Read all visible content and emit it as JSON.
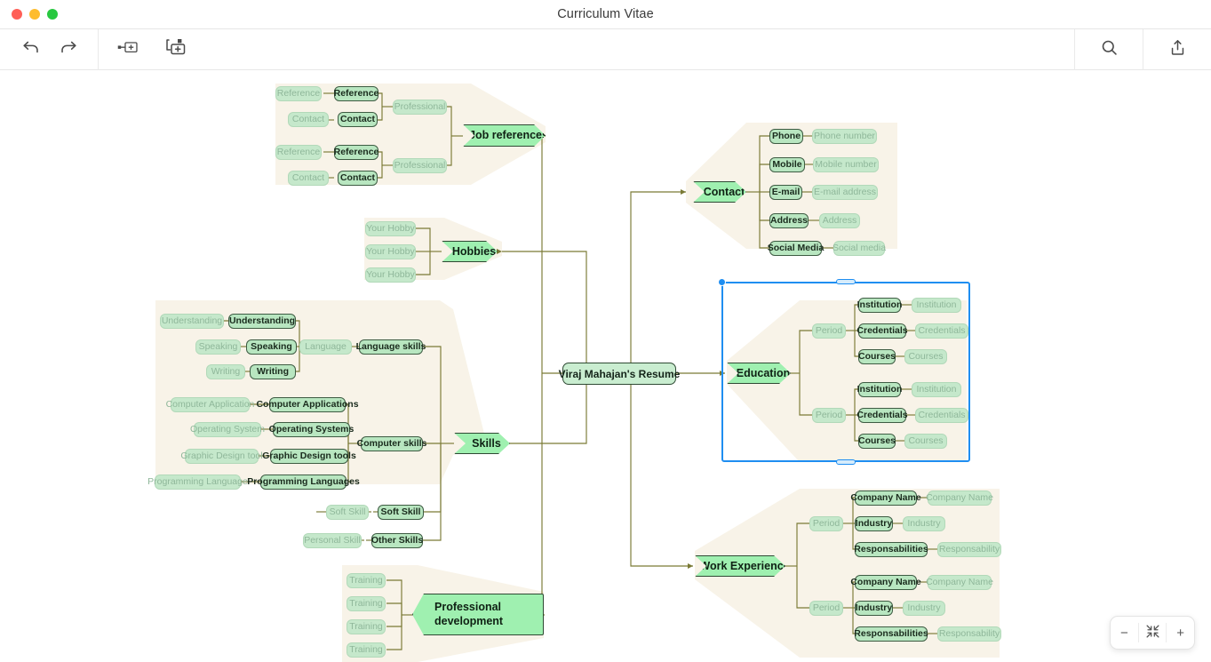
{
  "window": {
    "title": "Curriculum Vitae",
    "traffic_lights": [
      "close",
      "minimize",
      "maximize"
    ]
  },
  "toolbar": {
    "undo_icon": "undo-arrow-icon",
    "redo_icon": "redo-arrow-icon",
    "add_sibling_icon": "add-sibling-node-icon",
    "add_child_icon": "add-child-node-icon",
    "search_icon": "search-icon",
    "share_icon": "share-export-icon"
  },
  "zoom_controls": {
    "zoom_out": "−",
    "fit_screen": "fit-to-screen-icon",
    "zoom_in": "+"
  },
  "mindmap": {
    "root": "Viraj Mahajan's Resume",
    "selected_branch": "Education",
    "branches": [
      {
        "label": "Job references",
        "side": "left",
        "groups": [
          {
            "label": "Professional",
            "items": [
              {
                "label": "Reference",
                "placeholder": "Reference"
              },
              {
                "label": "Contact",
                "placeholder": "Contact"
              }
            ]
          },
          {
            "label": "Professional",
            "items": [
              {
                "label": "Reference",
                "placeholder": "Reference"
              },
              {
                "label": "Contact",
                "placeholder": "Contact"
              }
            ]
          }
        ]
      },
      {
        "label": "Hobbies",
        "side": "left",
        "leaves": [
          "Your Hobby",
          "Your Hobby",
          "Your Hobby"
        ]
      },
      {
        "label": "Skills",
        "side": "left",
        "groups": [
          {
            "label": "Language skills",
            "sub": "Language",
            "items": [
              {
                "label": "Understanding",
                "placeholder": "Understanding"
              },
              {
                "label": "Speaking",
                "placeholder": "Speaking"
              },
              {
                "label": "Writing",
                "placeholder": "Writing"
              }
            ]
          },
          {
            "label": "Computer skills",
            "items": [
              {
                "label": "Computer Applications",
                "placeholder": "Computer Application"
              },
              {
                "label": "Operating Systems",
                "placeholder": "Operating System"
              },
              {
                "label": "Graphic Design tools",
                "placeholder": "Graphic Design tool"
              },
              {
                "label": "Programming Languages",
                "placeholder": "Programming Language"
              }
            ]
          },
          {
            "label": "Soft Skill",
            "placeholder": "Soft Skill"
          },
          {
            "label": "Other Skills",
            "placeholder": "Personal Skill"
          }
        ]
      },
      {
        "label": "Professional development",
        "side": "left",
        "leaves": [
          "Training",
          "Training",
          "Training",
          "Training"
        ]
      },
      {
        "label": "Contact",
        "side": "right",
        "items": [
          {
            "label": "Phone",
            "placeholder": "Phone number"
          },
          {
            "label": "Mobile",
            "placeholder": "Mobile number"
          },
          {
            "label": "E-mail",
            "placeholder": "E-mail address"
          },
          {
            "label": "Address",
            "placeholder": "Address"
          },
          {
            "label": "Social Media",
            "placeholder": "Social media"
          }
        ]
      },
      {
        "label": "Education",
        "side": "right",
        "groups": [
          {
            "label": "Period",
            "items": [
              {
                "label": "Institution",
                "placeholder": "Institution"
              },
              {
                "label": "Credentials",
                "placeholder": "Credentials"
              },
              {
                "label": "Courses",
                "placeholder": "Courses"
              }
            ]
          },
          {
            "label": "Period",
            "items": [
              {
                "label": "Institution",
                "placeholder": "Institution"
              },
              {
                "label": "Credentials",
                "placeholder": "Credentials"
              },
              {
                "label": "Courses",
                "placeholder": "Courses"
              }
            ]
          }
        ]
      },
      {
        "label": "Work Experience",
        "side": "right",
        "groups": [
          {
            "label": "Period",
            "items": [
              {
                "label": "Company Name",
                "placeholder": "Company Name"
              },
              {
                "label": "Industry",
                "placeholder": "Industry"
              },
              {
                "label": "Responsabilities",
                "placeholder": "Responsability"
              }
            ]
          },
          {
            "label": "Period",
            "items": [
              {
                "label": "Company Name",
                "placeholder": "Company Name"
              },
              {
                "label": "Industry",
                "placeholder": "Industry"
              },
              {
                "label": "Responsabilities",
                "placeholder": "Responsability"
              }
            ]
          }
        ]
      }
    ]
  },
  "colors": {
    "branch_tint": "#f8f3e8",
    "connector": "#7a7a35",
    "node_solid_fill": "#b8e6c0",
    "node_ghost_fill": "#c5e8cb",
    "branch_fill": "#9ff0b0",
    "selection": "#1f8ef1"
  }
}
